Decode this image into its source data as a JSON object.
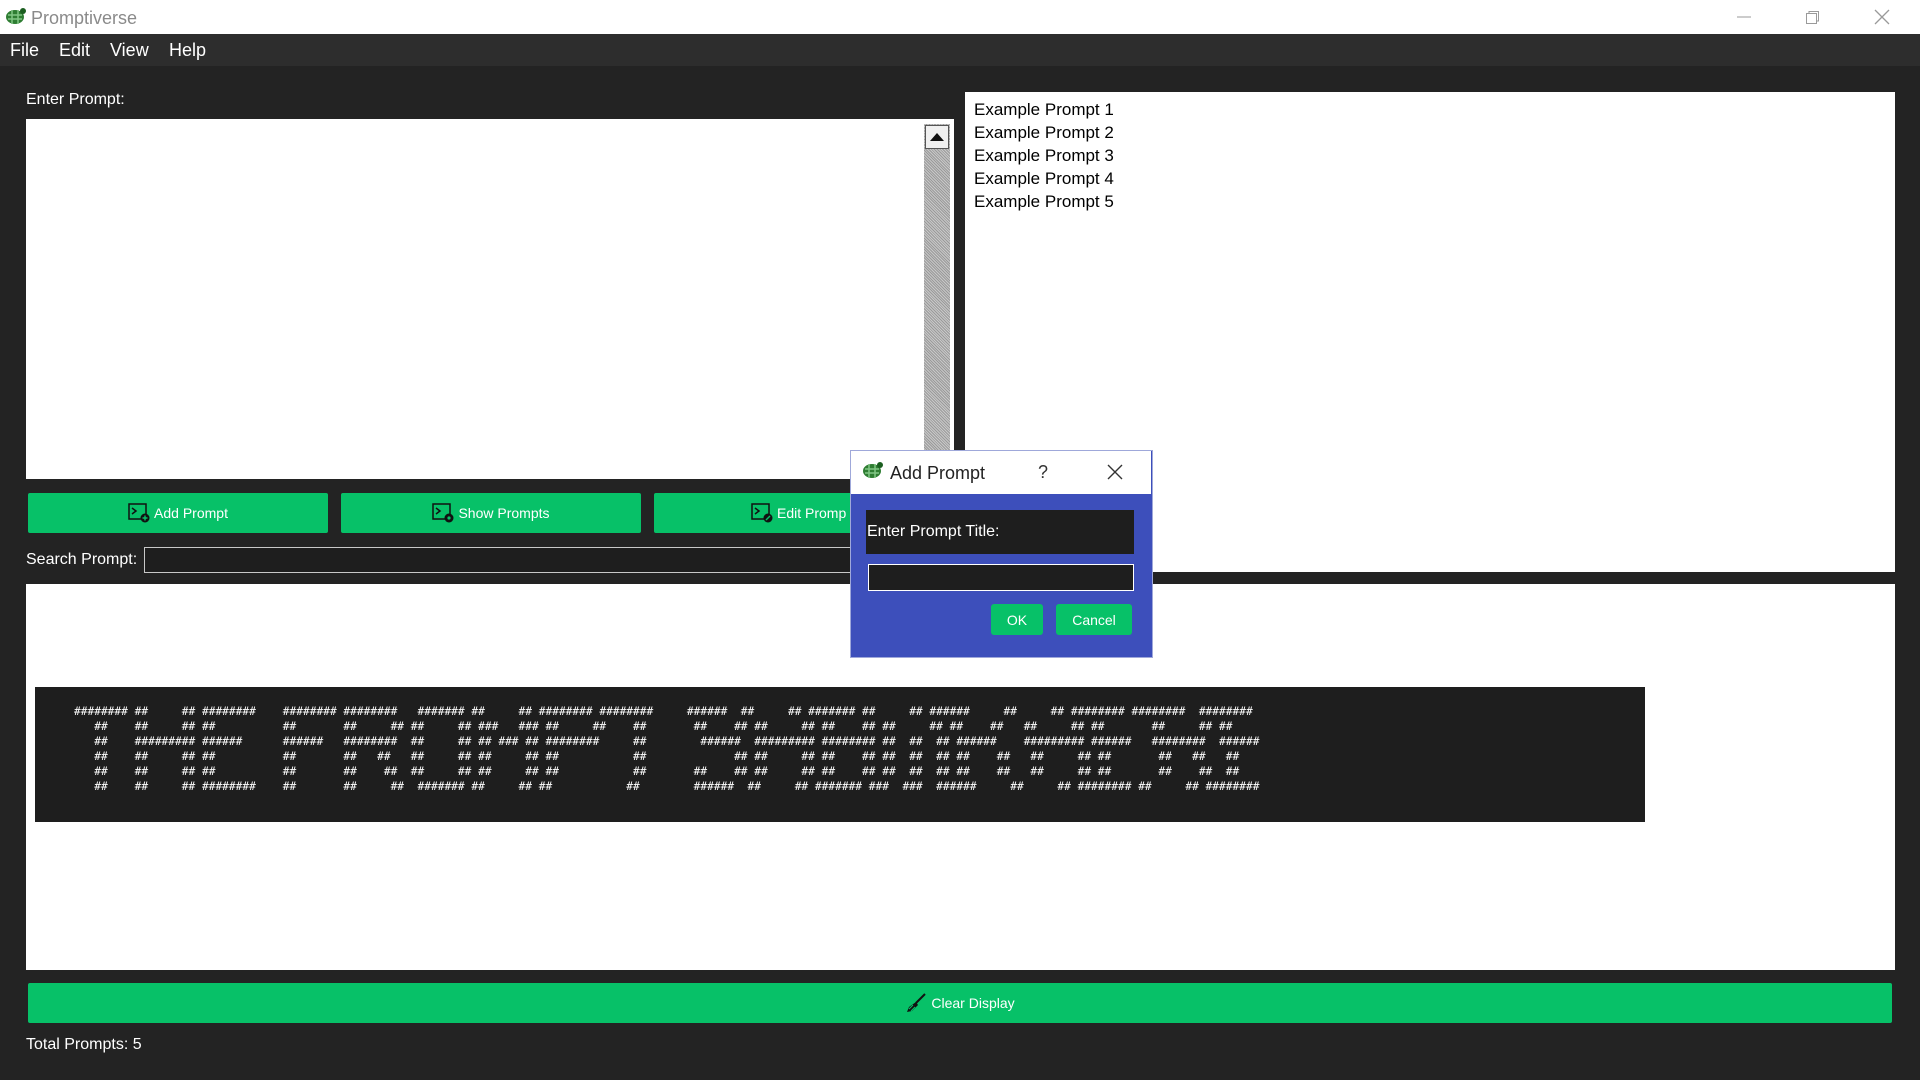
{
  "app": {
    "title": "Promptiverse"
  },
  "menu": [
    "File",
    "Edit",
    "View",
    "Help"
  ],
  "labels": {
    "enter_prompt": "Enter Prompt:",
    "search_prompt": "Search Prompt:",
    "total_prompts": "Total Prompts: 5"
  },
  "buttons": {
    "add_prompt": "Add Prompt",
    "show_prompts": "Show Prompts",
    "edit_prompt": "Edit Promp",
    "clear_display": "Clear Display"
  },
  "prompt_list": [
    "Example Prompt 1",
    "Example Prompt 2",
    "Example Prompt 3",
    "Example Prompt 4",
    "Example Prompt 5"
  ],
  "ascii_banner": [
    "######## ##     ## ########    ######## ########   ####### ##     ## ######## ########     ######  ##     ## ####### ##     ## ######     ##     ## ######## ########  ########",
    "   ##    ##     ## ##          ##       ##     ## ##     ## ###   ### ##     ##    ##       ##    ## ##     ## ##    ## ##     ## ##    ##   ##     ## ##       ##     ## ##",
    "   ##    ######### ######      ######   ########  ##     ## ## ### ## ########     ##        ######  ######### ######## ##  ##  ## ######    ######### ######   ########  ######",
    "   ##    ##     ## ##          ##       ##   ##   ##     ## ##     ## ##           ##             ## ##     ## ##    ## ##  ##  ## ##    ##   ##     ## ##       ##   ##   ##",
    "   ##    ##     ## ##          ##       ##    ##  ##     ## ##     ## ##           ##       ##    ## ##     ## ##    ## ##  ##  ## ##    ##   ##     ## ##       ##    ##  ##",
    "   ##    ##     ## ########    ##       ##     ##  ####### ##     ## ##           ##        ######  ##     ## ####### ###  ###  ######     ##     ## ######## ##     ## ########"
  ],
  "dialog": {
    "title": "Add Prompt",
    "help": "?",
    "label": "Enter Prompt Title:",
    "input_value": "",
    "ok": "OK",
    "cancel": "Cancel"
  },
  "colors": {
    "accent_green": "#07c168",
    "dialog_blue": "#3d4fbb",
    "background": "#232323"
  },
  "icons": {
    "app_logo": "turtle-logo-icon",
    "add": "terminal-plus-icon",
    "show": "terminal-eye-icon",
    "edit": "terminal-edit-icon",
    "clear": "broom-icon"
  }
}
